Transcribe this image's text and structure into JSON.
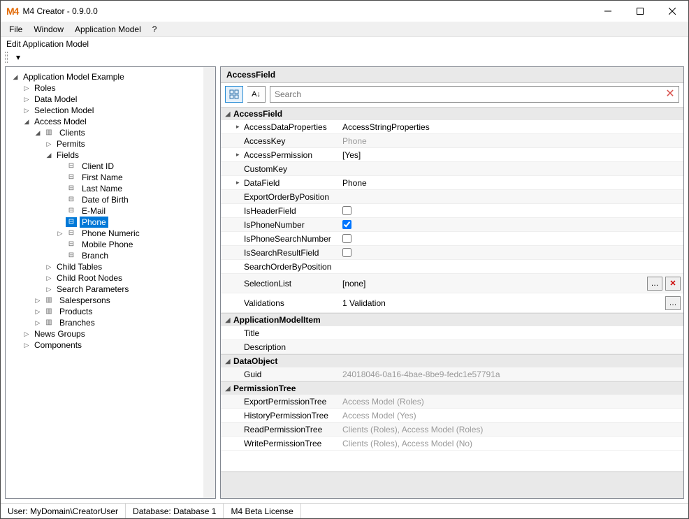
{
  "window": {
    "title": "M4 Creator - 0.9.0.0"
  },
  "menu": {
    "file": "File",
    "window": "Window",
    "appmodel": "Application Model",
    "help": "?"
  },
  "toolcaption": "Edit Application Model",
  "tree": {
    "root": "Application Model Example",
    "roles": "Roles",
    "datamodel": "Data Model",
    "selectionmodel": "Selection Model",
    "accessmodel": "Access Model",
    "clients": "Clients",
    "permits": "Permits",
    "fields": "Fields",
    "f0": "Client ID",
    "f1": "First Name",
    "f2": "Last Name",
    "f3": "Date of Birth",
    "f4": "E-Mail",
    "f5": "Phone",
    "f6": "Phone Numeric",
    "f7": "Mobile Phone",
    "f8": "Branch",
    "childtables": "Child Tables",
    "childroot": "Child Root Nodes",
    "searchparams": "Search Parameters",
    "salespersons": "Salespersons",
    "products": "Products",
    "branches": "Branches",
    "newsgroups": "News Groups",
    "components": "Components"
  },
  "prop": {
    "header": "AccessField",
    "search_placeholder": "Search",
    "cat1": "AccessField",
    "p_accessdata_l": "AccessDataProperties",
    "p_accessdata_v": "AccessStringProperties",
    "p_accesskey_l": "AccessKey",
    "p_accesskey_v": "Phone",
    "p_accessperm_l": "AccessPermission",
    "p_accessperm_v": "[Yes]",
    "p_customkey_l": "CustomKey",
    "p_customkey_v": "",
    "p_datafield_l": "DataField",
    "p_datafield_v": "Phone",
    "p_exportorder_l": "ExportOrderByPosition",
    "p_exportorder_v": "",
    "p_isheader_l": "IsHeaderField",
    "p_isphone_l": "IsPhoneNumber",
    "p_isphonesearch_l": "IsPhoneSearchNumber",
    "p_issearchres_l": "IsSearchResultField",
    "p_searchorder_l": "SearchOrderByPosition",
    "p_searchorder_v": "",
    "p_selectionlist_l": "SelectionList",
    "p_selectionlist_v": "[none]",
    "p_validations_l": "Validations",
    "p_validations_v": "1 Validation",
    "cat2": "ApplicationModelItem",
    "p_title_l": "Title",
    "p_title_v": "",
    "p_desc_l": "Description",
    "p_desc_v": "",
    "cat3": "DataObject",
    "p_guid_l": "Guid",
    "p_guid_v": "24018046-0a16-4bae-8be9-fedc1e57791a",
    "cat4": "PermissionTree",
    "p_expperm_l": "ExportPermissionTree",
    "p_expperm_v": "Access Model (Roles)",
    "p_histperm_l": "HistoryPermissionTree",
    "p_histperm_v": "Access Model (Yes)",
    "p_readperm_l": "ReadPermissionTree",
    "p_readperm_v": "Clients (Roles), Access Model (Roles)",
    "p_writeperm_l": "WritePermissionTree",
    "p_writeperm_v": "Clients (Roles), Access Model (No)"
  },
  "status": {
    "user": "User: MyDomain\\CreatorUser",
    "db": "Database: Database 1",
    "lic": "M4 Beta License"
  },
  "checks": {
    "isheader": false,
    "isphone": true,
    "isphonesearch": false,
    "issearchres": false
  }
}
